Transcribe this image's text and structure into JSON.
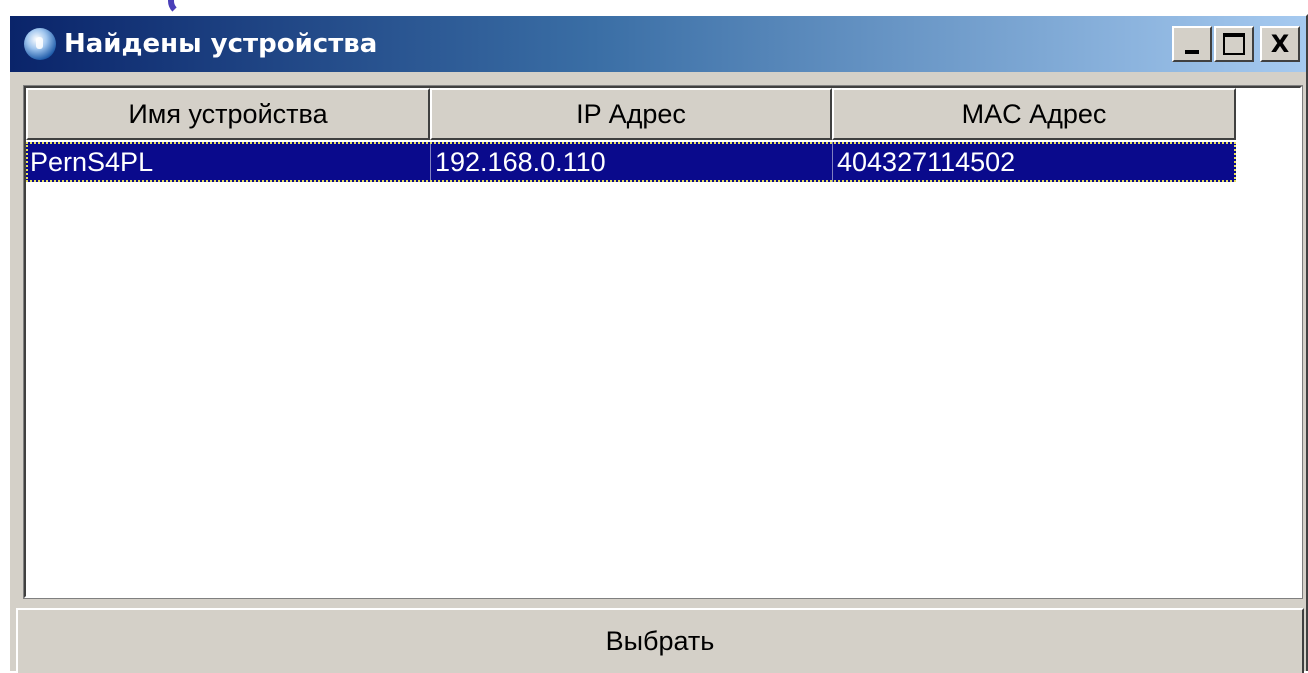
{
  "window": {
    "title": "Найдены устройства"
  },
  "title_buttons": {
    "close": "X"
  },
  "table": {
    "columns": [
      "Имя устройства",
      "IP Адрес",
      "MAC Адрес"
    ],
    "rows": [
      {
        "name": "PernS4PL",
        "ip": "192.168.0.110",
        "mac": "404327114502",
        "selected": true
      }
    ]
  },
  "footer": {
    "select_label": "Выбрать"
  },
  "colors": {
    "title_gradient_start": "#0a246a",
    "title_gradient_end": "#a6caf0",
    "selection": "#0a0a8c",
    "face": "#d4d0c8"
  }
}
